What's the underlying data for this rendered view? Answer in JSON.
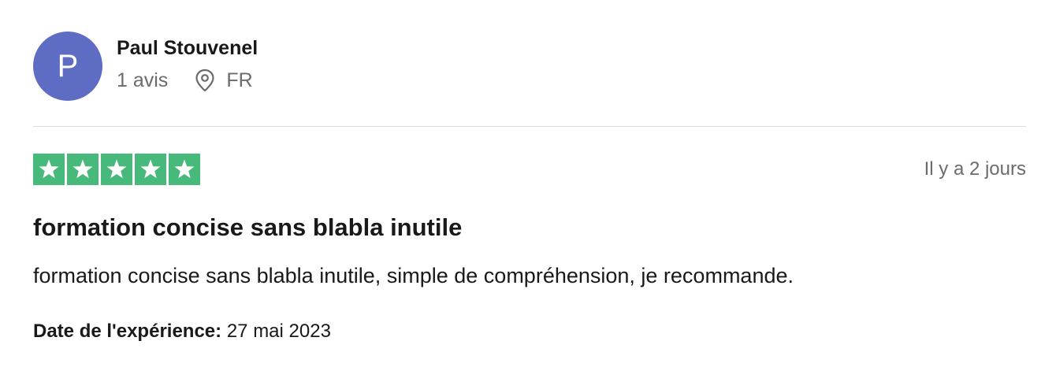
{
  "reviewer": {
    "initial": "P",
    "name": "Paul Stouvenel",
    "review_count": "1 avis",
    "country": "FR",
    "avatar_color": "#5e6cc3"
  },
  "icons": {
    "location": "map-pin-icon",
    "star": "star-icon"
  },
  "rating": {
    "stars": 5,
    "max": 5,
    "star_color": "#47b97a"
  },
  "review": {
    "posted": "Il y a 2 jours",
    "title": "formation concise sans blabla inutile",
    "body": "formation concise sans blabla inutile, simple de compréhension, je recommande.",
    "experience_label": "Date de l'expérience:",
    "experience_date": "27 mai 2023"
  }
}
